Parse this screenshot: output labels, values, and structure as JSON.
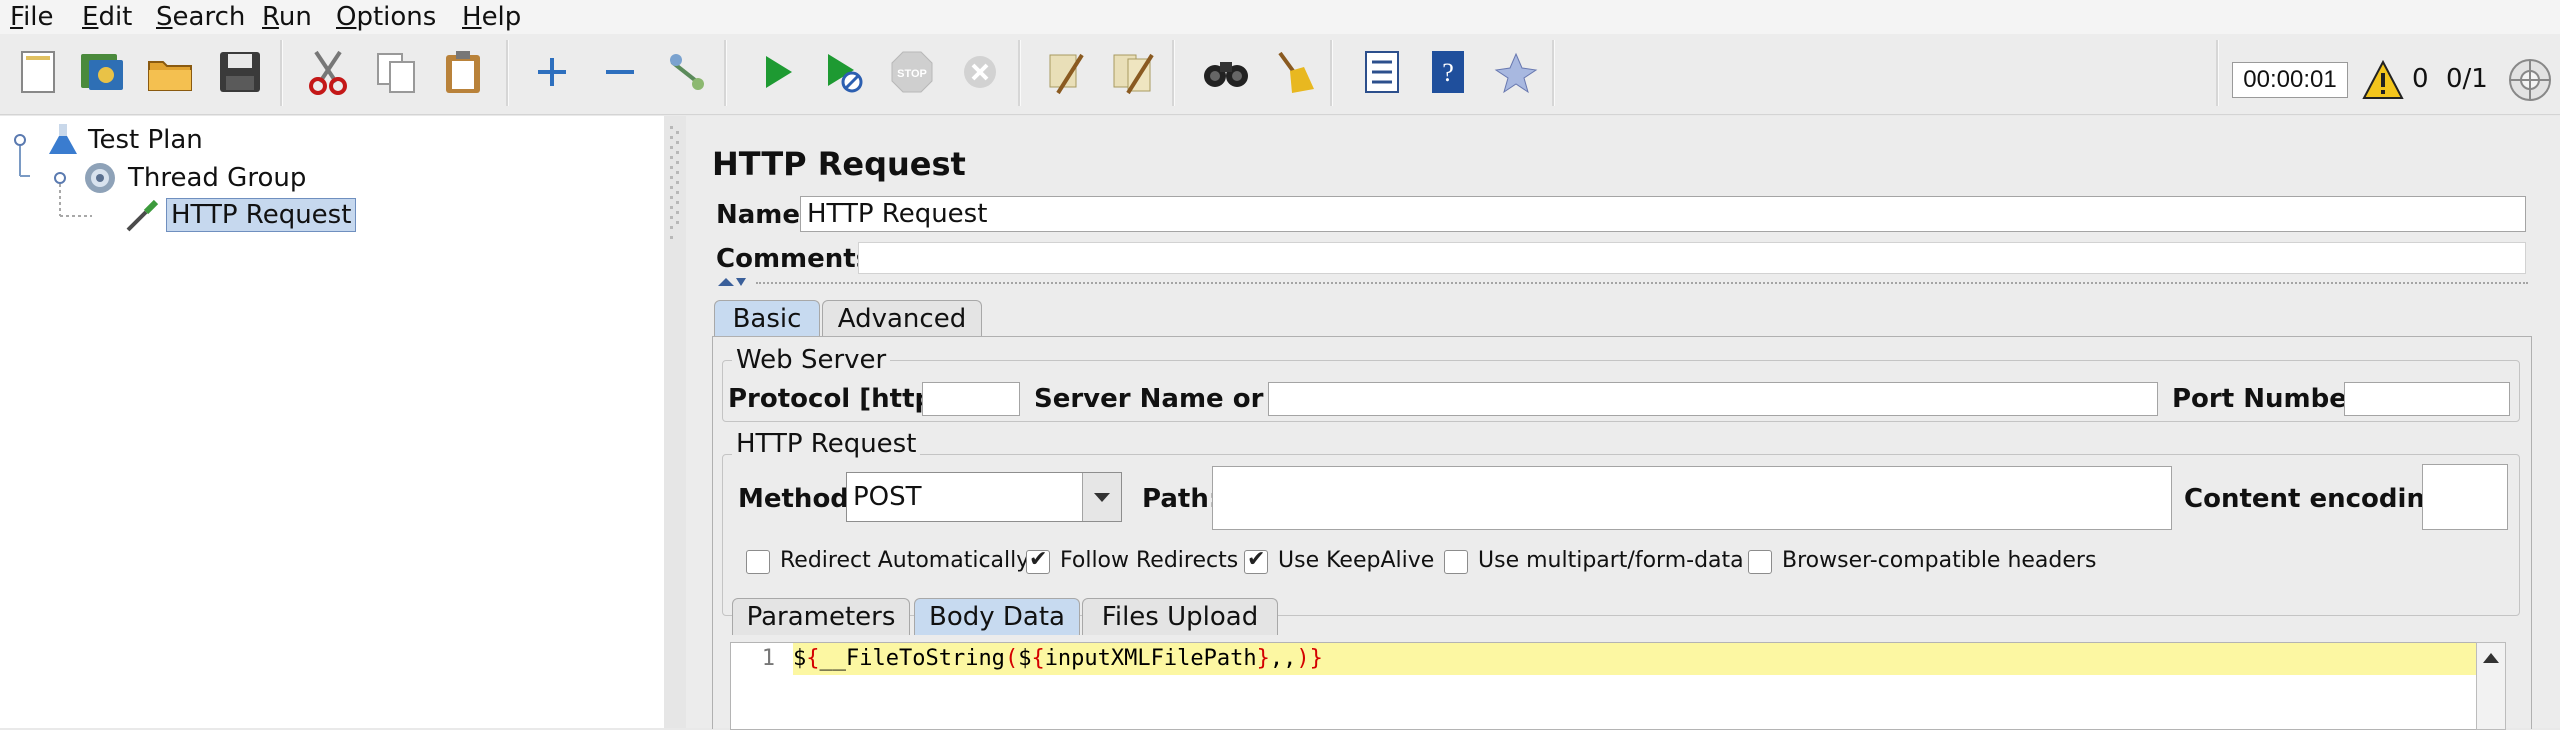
{
  "menu": [
    {
      "first": "F",
      "rest": "ile"
    },
    {
      "first": "E",
      "rest": "dit"
    },
    {
      "first": "S",
      "rest": "earch"
    },
    {
      "first": "R",
      "rest": "un"
    },
    {
      "first": "O",
      "rest": "ptions"
    },
    {
      "first": "H",
      "rest": "elp"
    }
  ],
  "toolbar": {
    "buttons": [
      "new-icon",
      "templates-icon",
      "open-icon",
      "save-icon",
      "cut-icon",
      "copy-icon",
      "paste-icon",
      "expand-icon",
      "collapse-icon",
      "toggle-icon",
      "start-icon",
      "start-no-pause-icon",
      "stop-icon",
      "shutdown-icon",
      "clear-icon",
      "clear-all-icon",
      "search-icon",
      "reset-search-icon",
      "function-helper-icon",
      "help-icon",
      "remote-icon"
    ],
    "timer": "00:00:01",
    "warning_count": "0",
    "threads": "0/1"
  },
  "tree": {
    "items": [
      {
        "label": "Test Plan",
        "icon": "flask-icon"
      },
      {
        "label": "Thread Group",
        "icon": "gear-icon"
      },
      {
        "label": "HTTP Request",
        "icon": "pipette-icon"
      }
    ]
  },
  "panel": {
    "title": "HTTP Request",
    "name_label": "Name:",
    "name_value": "HTTP Request",
    "comments_label": "Comments:",
    "tabs": [
      "Basic",
      "Advanced"
    ],
    "web_server": {
      "title": "Web Server",
      "protocol_label": "Protocol [http]:",
      "server_label": "Server Name or IP:",
      "port_label": "Port Number:"
    },
    "http_request": {
      "title": "HTTP Request",
      "method_label": "Method:",
      "method_value": "POST",
      "path_label": "Path:",
      "encoding_label": "Content encoding:"
    },
    "checkboxes": [
      {
        "label": "Redirect Automatically",
        "checked": false
      },
      {
        "label": "Follow Redirects",
        "checked": true
      },
      {
        "label": "Use KeepAlive",
        "checked": true
      },
      {
        "label": "Use multipart/form-data",
        "checked": false
      },
      {
        "label": "Browser-compatible headers",
        "checked": false
      }
    ],
    "subtabs": [
      "Parameters",
      "Body Data",
      "Files Upload"
    ],
    "editor": {
      "line_number": "1",
      "tokens": [
        {
          "text": "$",
          "color": "#000000"
        },
        {
          "text": "{",
          "color": "#d40000"
        },
        {
          "text": "__FileToString",
          "color": "#000000"
        },
        {
          "text": "(",
          "color": "#d40000"
        },
        {
          "text": "$",
          "color": "#000000"
        },
        {
          "text": "{",
          "color": "#d40000"
        },
        {
          "text": "inputXMLFilePath",
          "color": "#000000"
        },
        {
          "text": "}",
          "color": "#d40000"
        },
        {
          "text": ",,",
          "color": "#000000"
        },
        {
          "text": ")",
          "color": "#d40000"
        },
        {
          "text": "}",
          "color": "#d40000"
        }
      ]
    }
  }
}
